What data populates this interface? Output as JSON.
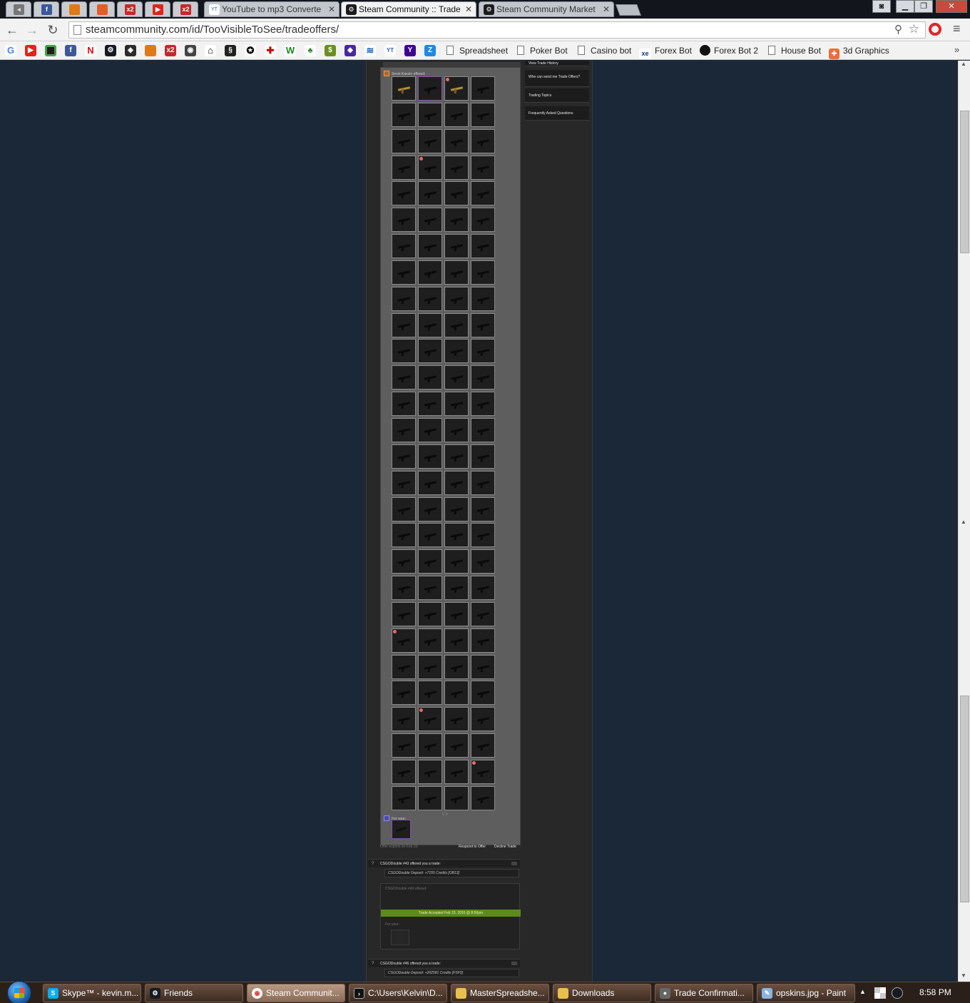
{
  "browser": {
    "tabs": [
      {
        "title": "YouTube to mp3 Converte",
        "icon": "yt-mp3-icon",
        "active": false
      },
      {
        "title": "Steam Community :: Trade",
        "icon": "steam-icon",
        "active": true
      },
      {
        "title": "Steam Community Market",
        "icon": "steam-icon",
        "active": false
      }
    ],
    "close_glyph": "✕",
    "url": "steamcommunity.com/id/TooVisibleToSee/tradeoffers/",
    "bookmarks": [
      "Spreadsheet",
      "Poker Bot",
      "Casino bot",
      "Forex Bot",
      "Forex Bot 2",
      "House Bot",
      "3d Graphics"
    ],
    "bookmark_icon_text": {
      "x2": "x2",
      "yt": "YT",
      "y": "Y",
      "z": "Z",
      "xe": "xe"
    }
  },
  "sidebar": {
    "links": [
      "View Trade History",
      "Who can send me Trade Offers?",
      "Trading Topics",
      "Frequently Asked Questions"
    ]
  },
  "offer1": {
    "offerer": "Sevin Kacoin offered:",
    "for_your": "For your:",
    "pager": "‹ ›",
    "expires": "Offer expires on Feb 23",
    "respond": "Respond to Offer",
    "decline": "Decline Trade",
    "item_count": 112,
    "selected_slot": 1,
    "featured_slots": [
      0,
      2
    ],
    "sticker_slots": [
      2,
      13,
      84,
      97,
      107
    ]
  },
  "offer2": {
    "q": "?",
    "title": "CSGODouble #43 offered you a trade:",
    "note": "CSGODouble Deposit: +7155 Credits [OB13]",
    "offerer": "CSGODouble #43 offered:",
    "status": "Trade Accepted Feb 15, 2016 @ 8:50pm",
    "for_your": "For your:"
  },
  "offer3": {
    "q": "?",
    "title": "CSGODouble #46 offered you a trade:",
    "note": "CSGODouble Deposit: +202581 Credits [FSF0]"
  },
  "taskbar": {
    "items": [
      "Skype™ - kevin.m...",
      "Friends",
      "Steam Communit...",
      "C:\\Users\\Kelvin\\D...",
      "MasterSpreadshe...",
      "Downloads",
      "Trade Confirmati...",
      "opskins.jpg - Paint"
    ],
    "clock": "8:58 PM"
  },
  "colors": {
    "page_bg": "#1b2838",
    "accepted_green": "#5c8a1d",
    "selected_border": "#8650ac"
  }
}
